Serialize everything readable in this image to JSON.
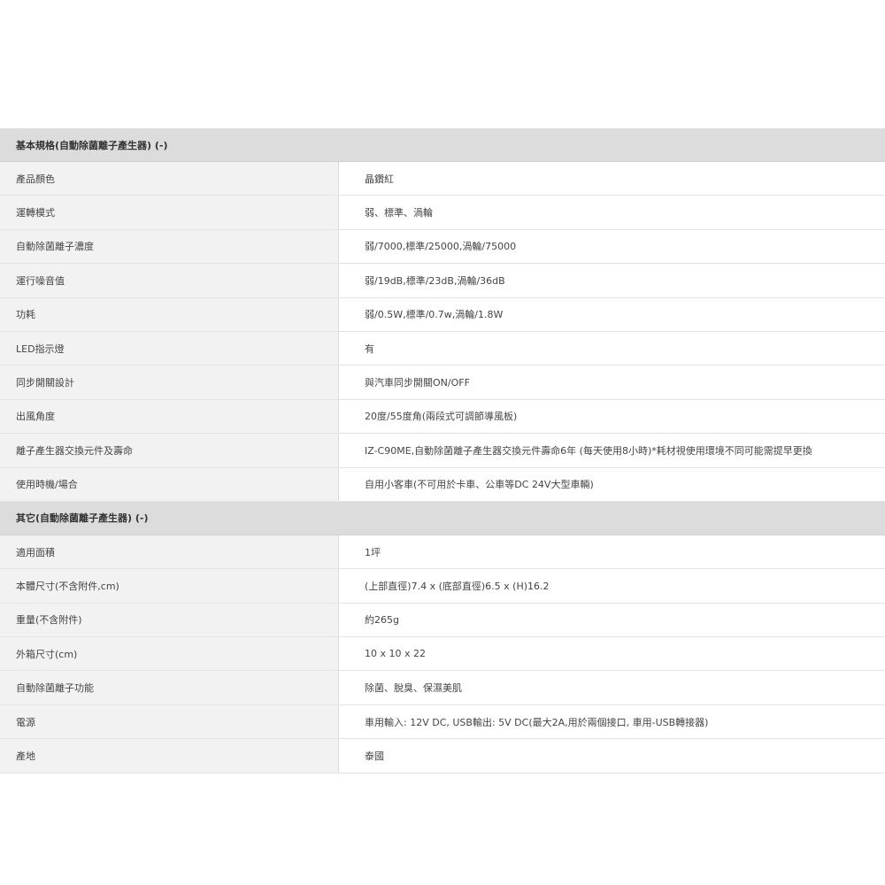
{
  "sections": [
    {
      "title": "基本規格(自動除菌離子產生器) (-)",
      "rows": [
        {
          "label": "產品顏色",
          "value": "晶鑽紅"
        },
        {
          "label": "運轉模式",
          "value": "弱、標準、渦輪"
        },
        {
          "label": "自動除菌離子濃度",
          "value": "弱/7000,標準/25000,渦輪/75000"
        },
        {
          "label": "運行噪音值",
          "value": "弱/19dB,標準/23dB,渦輪/36dB"
        },
        {
          "label": "功耗",
          "value": "弱/0.5W,標準/0.7w,渦輪/1.8W"
        },
        {
          "label": "LED指示燈",
          "value": "有"
        },
        {
          "label": "同步開關設計",
          "value": "與汽車同步開關ON/OFF"
        },
        {
          "label": "出風角度",
          "value": "20度/55度角(兩段式可調節導風板)"
        },
        {
          "label": "離子產生器交換元件及壽命",
          "value": "IZ-C90ME,自動除菌離子產生器交換元件壽命6年 (每天使用8小時)*耗材視使用環境不同可能需提早更換"
        },
        {
          "label": "使用時機/場合",
          "value": "自用小客車(不可用於卡車、公車等DC 24V大型車輛)"
        }
      ]
    },
    {
      "title": "其它(自動除菌離子產生器) (-)",
      "rows": [
        {
          "label": "適用面積",
          "value": "1坪"
        },
        {
          "label": "本體尺寸(不含附件,cm)",
          "value": "(上部直徑)7.4 x (底部直徑)6.5 x (H)16.2"
        },
        {
          "label": "重量(不含附件)",
          "value": "約265g"
        },
        {
          "label": "外箱尺寸(cm)",
          "value": "10 x 10 x 22"
        },
        {
          "label": "自動除菌離子功能",
          "value": "除菌、脫臭、保濕美肌"
        },
        {
          "label": "電源",
          "value": "車用輸入: 12V DC, USB輸出: 5V DC(最大2A,用於兩個接口, 車用-USB轉接器)"
        },
        {
          "label": "產地",
          "value": "泰國"
        }
      ]
    }
  ]
}
